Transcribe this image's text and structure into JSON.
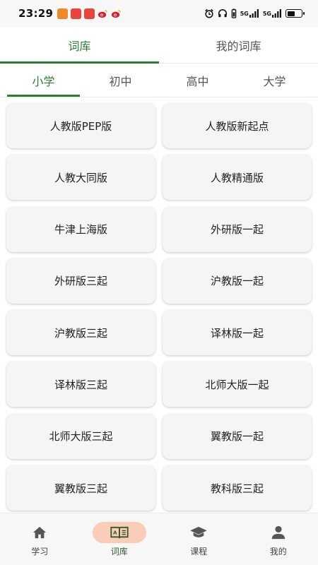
{
  "status_bar": {
    "time": "23:29",
    "network_labels": [
      "5G",
      "5G"
    ],
    "battery_level": 0.55,
    "notification_icons": [
      "app-icon-orange",
      "app-icon-red",
      "app-icon-red",
      "weibo-icon",
      "weibo-icon"
    ]
  },
  "top_tabs": [
    {
      "label": "词库",
      "active": true
    },
    {
      "label": "我的词库",
      "active": false
    }
  ],
  "level_tabs": [
    {
      "label": "小学",
      "active": true
    },
    {
      "label": "初中",
      "active": false
    },
    {
      "label": "高中",
      "active": false
    },
    {
      "label": "大学",
      "active": false
    }
  ],
  "textbooks": [
    "人教版PEP版",
    "人教版新起点",
    "人教大同版",
    "人教精通版",
    "牛津上海版",
    "外研版一起",
    "外研版三起",
    "沪教版一起",
    "沪教版三起",
    "译林版一起",
    "译林版三起",
    "北师大版一起",
    "北师大版三起",
    "翼教版一起",
    "翼教版三起",
    "教科版三起"
  ],
  "bottom_nav": [
    {
      "label": "学习",
      "icon": "home-icon",
      "active": false
    },
    {
      "label": "词库",
      "icon": "book-icon",
      "active": true
    },
    {
      "label": "课程",
      "icon": "graduation-cap-icon",
      "active": false
    },
    {
      "label": "我的",
      "icon": "person-icon",
      "active": false
    }
  ],
  "colors": {
    "accent": "#2e7d32",
    "nav_active_bg": "#f9cdb8",
    "card_bg": "#f5f5f5"
  }
}
